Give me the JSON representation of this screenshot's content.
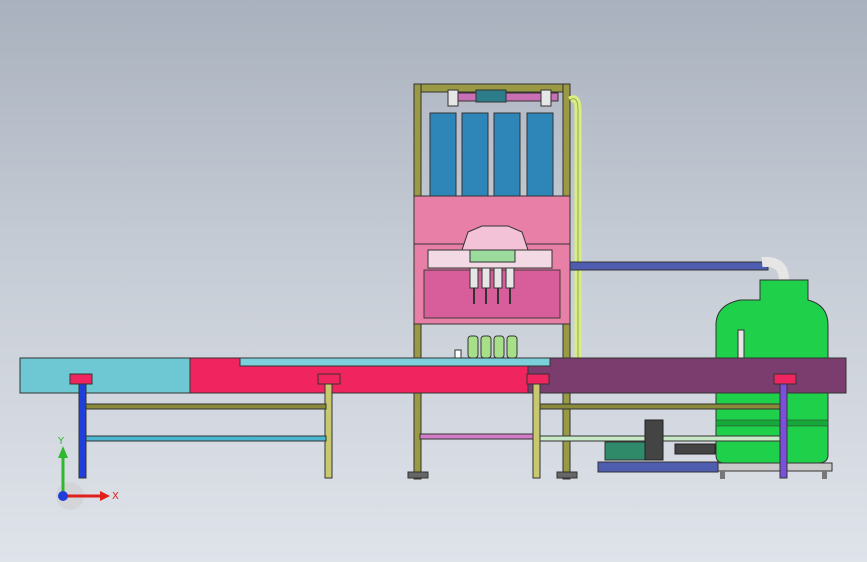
{
  "viewport": {
    "background_top": "#a9b1be",
    "background_bottom": "#dfe3ea"
  },
  "triad": {
    "x_label": "X",
    "y_label": "Y",
    "x_color": "#e0201a",
    "y_color": "#2fb82f",
    "z_color": "#1f3fd8"
  },
  "colors": {
    "conveyor_left": "#6ec8d3",
    "conveyor_mid": "#f0245e",
    "conveyor_right": "#7a3d6e",
    "frame": "#8c8c3a",
    "filler_head": "#e77fa6",
    "tanks": "#2e86b8",
    "water_tank": "#1fd14a",
    "pipe": "#4e5db0",
    "crossbar_olive": "#8a8a3a",
    "crossbar_cyan": "#4ab6d0"
  }
}
